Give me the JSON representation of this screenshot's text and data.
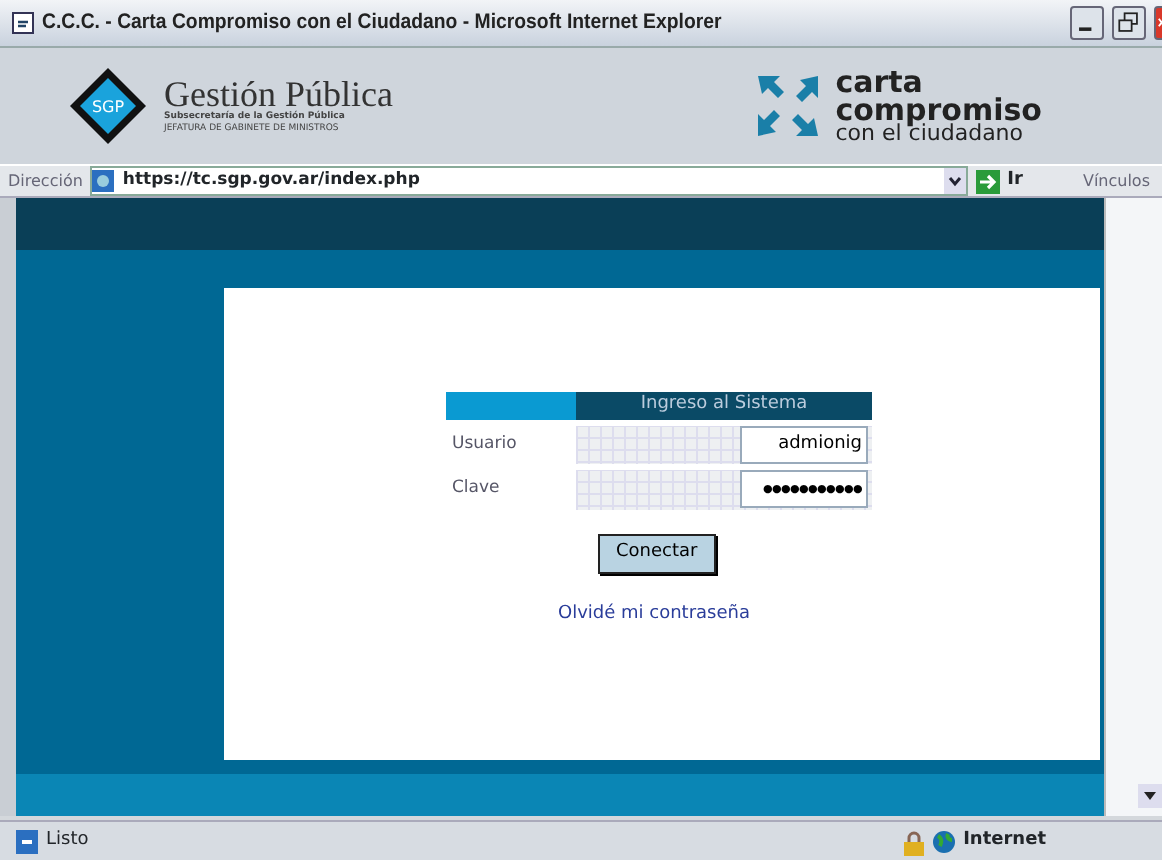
{
  "window": {
    "title": "C.C.C. - Carta Compromiso con el Ciudadano - Microsoft Internet Explorer"
  },
  "header": {
    "left_logo": {
      "badge": "SGP",
      "name": "Gestión Pública",
      "line_1": "Subsecretaría de la Gestión Pública",
      "line_2": "JEFATURA DE GABINETE DE MINISTROS"
    },
    "right_logo": {
      "line_1": "carta",
      "line_2": "compromiso",
      "line_3": "con el ciudadano"
    }
  },
  "address_bar": {
    "label": "Dirección",
    "url": "https://tc.sgp.gov.ar/index.php",
    "go": "Ir",
    "links": "Vínculos"
  },
  "login": {
    "title": "Ingreso al Sistema",
    "fields": [
      {
        "label": "Usuario",
        "value": "admionig"
      },
      {
        "label": "Clave",
        "value": "●●●●●●●●●●●"
      }
    ],
    "button": "Conectar",
    "forgot_link": "Olvidé mi contraseña"
  },
  "status_bar": {
    "text": "Listo",
    "zone": "Internet"
  }
}
